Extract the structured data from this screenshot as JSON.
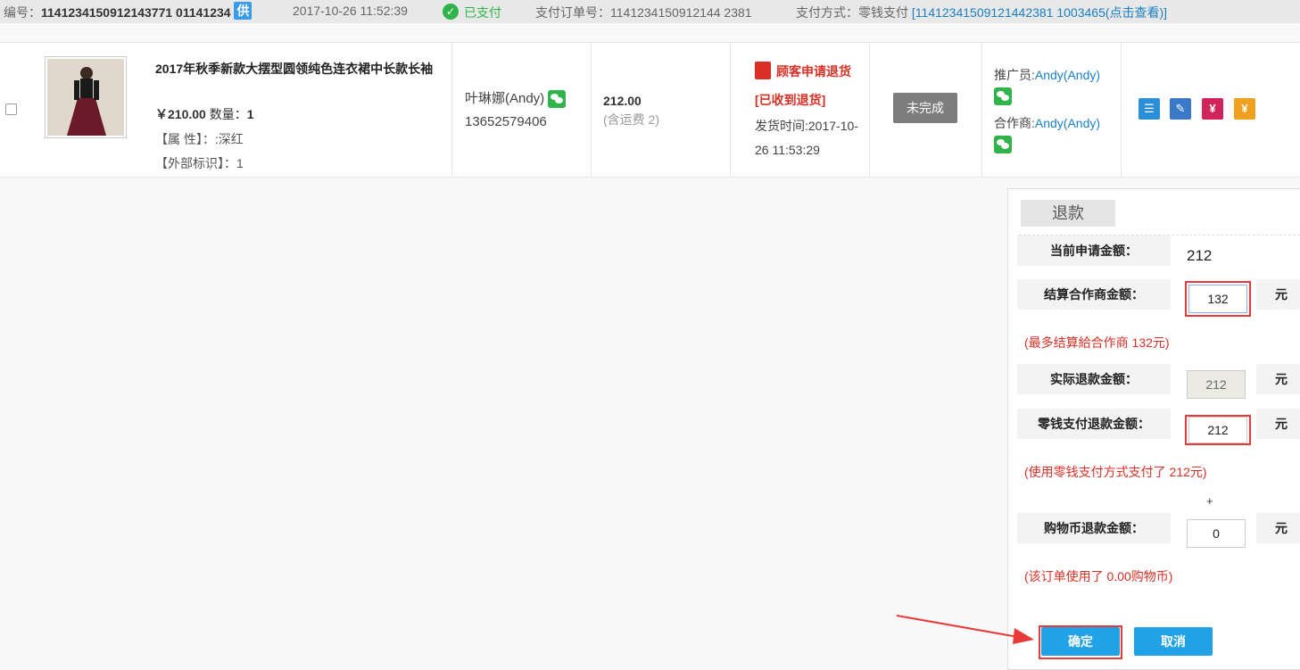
{
  "header": {
    "order_no_label": "编号：",
    "order_no": "1141234150912143771 01141234",
    "supply_badge": "供",
    "datetime": "2017-10-26 11:52:39",
    "paid_status": "已支付",
    "pay_order_label": "支付订单号：",
    "pay_order_no": "1141234150912144 2381",
    "pay_method_label": "支付方式：零钱支付",
    "pay_method_link": "[11412341509121442381 1003465(点击查看)]"
  },
  "order": {
    "product_title": "2017年秋季新款大摆型圆领纯色连衣裙中长款长袖",
    "price": "￥210.00",
    "qty_label": "数量：",
    "qty": "1",
    "attr": "【属 性】：:深红",
    "ext": "【外部标识】：1",
    "buyer_name": "叶琳娜(Andy)",
    "buyer_phone": "13652579406",
    "amount": "212.00",
    "shipping": "(含运费 2)",
    "return_request": "顾客申请退货",
    "received": "[已收到退货]",
    "ship_time": "发货时间:2017-10-26 11:53:29",
    "status_button": "未完成",
    "promoter_label": "推广员:",
    "promoter": "Andy(Andy)",
    "partner_label": "合作商:",
    "partner": "Andy(Andy)"
  },
  "refund": {
    "tab": "退款",
    "current_label": "当前申请金额：",
    "current_value": "212",
    "settle_label": "结算合作商金额：",
    "settle_value": "132",
    "unit": "元",
    "settle_hint": "(最多结算給合作商 132元)",
    "actual_label": "实际退款金额：",
    "actual_value": "212",
    "wallet_label": "零钱支付退款金额：",
    "wallet_value": "212",
    "wallet_hint": "(使用零钱支付方式支付了 212元)",
    "plus": "+",
    "coin_label": "购物币退款金额：",
    "coin_value": "0",
    "coin_hint": "(该订单使用了 0.00购物币)",
    "confirm": "确定",
    "cancel": "取消"
  },
  "colors": {
    "accent_blue": "#22a2e6",
    "paid_green": "#2fb34a",
    "alert_red": "#d93025"
  }
}
